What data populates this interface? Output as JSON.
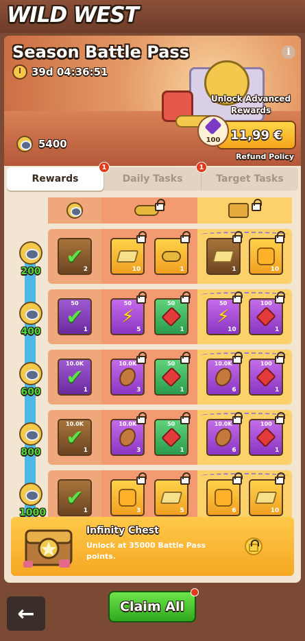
{
  "header": {
    "game_title": "WILD WEST"
  },
  "banner": {
    "title": "Season Battle Pass",
    "timer": "39d 04:36:51",
    "unlock_text": "Unlock Advanced Rewards",
    "price": "11,99 €",
    "gem_count": "100",
    "refund_link": "Refund Policy",
    "points": "5400"
  },
  "tabs": [
    {
      "label": "Rewards",
      "badge": "",
      "active": true
    },
    {
      "label": "Daily Tasks",
      "badge": "1",
      "active": false
    },
    {
      "label": "Target Tasks",
      "badge": "1",
      "active": false
    }
  ],
  "levels": [
    "200",
    "400",
    "600",
    "800",
    "1000"
  ],
  "rows": [
    {
      "points_card": {
        "style": "brown",
        "top": "",
        "qty": "2"
      },
      "free": [
        {
          "style": "gold",
          "item": "gold-bar",
          "top": "",
          "qty": "10"
        },
        {
          "style": "gold",
          "item": "coins",
          "top": "",
          "qty": "1"
        }
      ],
      "premium": [
        {
          "style": "brown",
          "item": "gold-bar",
          "top": "",
          "qty": "1"
        },
        {
          "style": "gold",
          "item": "puzzle",
          "top": "",
          "qty": "10"
        }
      ]
    },
    {
      "points_card": {
        "style": "done-purple",
        "top": "50",
        "qty": "1"
      },
      "free": [
        {
          "style": "purple",
          "item": "bolt",
          "top": "50",
          "qty": "5"
        },
        {
          "style": "green",
          "item": "gem",
          "top": "50",
          "qty": "1"
        }
      ],
      "premium": [
        {
          "style": "purple",
          "item": "bolt",
          "top": "50",
          "qty": "10"
        },
        {
          "style": "purple",
          "item": "gem",
          "top": "100",
          "qty": "1"
        }
      ]
    },
    {
      "points_card": {
        "style": "done-purple",
        "top": "10.0K",
        "qty": "1"
      },
      "free": [
        {
          "style": "purple",
          "item": "bean",
          "top": "10.0K",
          "qty": "3"
        },
        {
          "style": "green",
          "item": "gem",
          "top": "50",
          "qty": "1"
        }
      ],
      "premium": [
        {
          "style": "purple",
          "item": "bean",
          "top": "10.0K",
          "qty": "6"
        },
        {
          "style": "purple",
          "item": "gem",
          "top": "100",
          "qty": "1"
        }
      ]
    },
    {
      "points_card": {
        "style": "brown",
        "top": "10.0K",
        "qty": "1"
      },
      "free": [
        {
          "style": "purple",
          "item": "bean",
          "top": "10.0K",
          "qty": "3"
        },
        {
          "style": "green",
          "item": "gem",
          "top": "50",
          "qty": "1"
        }
      ],
      "premium": [
        {
          "style": "purple",
          "item": "bean",
          "top": "10.0K",
          "qty": "6"
        },
        {
          "style": "purple",
          "item": "gem",
          "top": "100",
          "qty": "1"
        }
      ]
    },
    {
      "points_card": {
        "style": "brown",
        "top": "",
        "qty": "1"
      },
      "free": [
        {
          "style": "gold",
          "item": "puzzle",
          "top": "",
          "qty": "3"
        },
        {
          "style": "gold",
          "item": "gold-bar",
          "top": "",
          "qty": "5"
        }
      ],
      "premium": [
        {
          "style": "gold",
          "item": "puzzle",
          "top": "",
          "qty": "6"
        },
        {
          "style": "gold",
          "item": "gold-bar",
          "top": "",
          "qty": "10"
        }
      ]
    }
  ],
  "infinity_chest": {
    "title": "Infinity Chest",
    "description": "Unlock at 35000 Battle Pass points."
  },
  "bottom": {
    "claim_label": "Claim All",
    "back_icon": "arrow-left-icon"
  },
  "colors": {
    "accent_gold": "#f5a722",
    "claim_green": "#2ea81e",
    "progress_blue": "#4fb8e6"
  }
}
